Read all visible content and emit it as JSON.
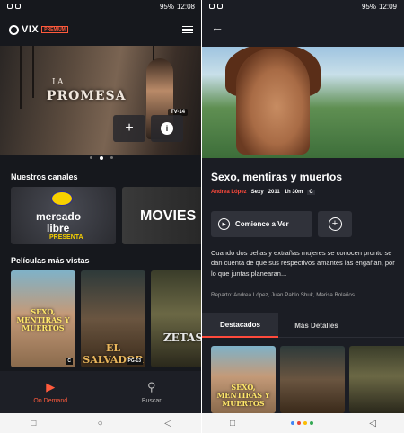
{
  "left": {
    "status": {
      "time": "12:08",
      "battery": "95%"
    },
    "logo": {
      "text": "VIX",
      "badge": "PREMIUM"
    },
    "hero": {
      "title": "PROMESA",
      "title_prefix": "LA",
      "rating": "TV-14"
    },
    "sections": {
      "channels": "Nuestros canales",
      "movies": "Películas más vistas"
    },
    "channels": [
      {
        "line1": "mercado",
        "line2": "libre",
        "line3": "PRESENTA"
      },
      {
        "line1": "MOVIES"
      }
    ],
    "posters": [
      {
        "title": "SEXO, MENTIRAS Y MUERTOS",
        "badge": "C"
      },
      {
        "title": "EL SALVADOR",
        "badge": "PG-13"
      },
      {
        "title": "ZETAS",
        "badge": ""
      }
    ],
    "bottom_nav": [
      {
        "label": "On Demand",
        "icon": "play-icon"
      },
      {
        "label": "Buscar",
        "icon": "search-icon"
      }
    ],
    "android_nav": [
      "□",
      "○",
      "◁"
    ]
  },
  "right": {
    "status": {
      "time": "12:09",
      "battery": "95%"
    },
    "title": "Sexo, mentiras y muertos",
    "meta": {
      "genre": "Andrea López",
      "tag1": "Sexy",
      "year": "2011",
      "duration": "1h 30m",
      "badge": "C"
    },
    "play_label": "Comience a Ver",
    "description": "Cuando dos bellas y extrañas mujeres se conocen pronto se dan cuenta de que sus respectivos amantes las engañan, por lo que juntas planearan...",
    "cast": "Reparto: Andrea López, Juan Pablo Shuk, Marisa Bolaños",
    "tabs": [
      {
        "label": "Destacados"
      },
      {
        "label": "Más Detalles"
      }
    ],
    "posters": [
      {
        "title": "SEXO, MENTIRAS Y MUERTOS"
      },
      {
        "title": ""
      },
      {
        "title": ""
      }
    ],
    "android_nav": [
      "□",
      "◁"
    ]
  },
  "colors": {
    "accent": "#ff4a3c",
    "background": "#16181d"
  }
}
